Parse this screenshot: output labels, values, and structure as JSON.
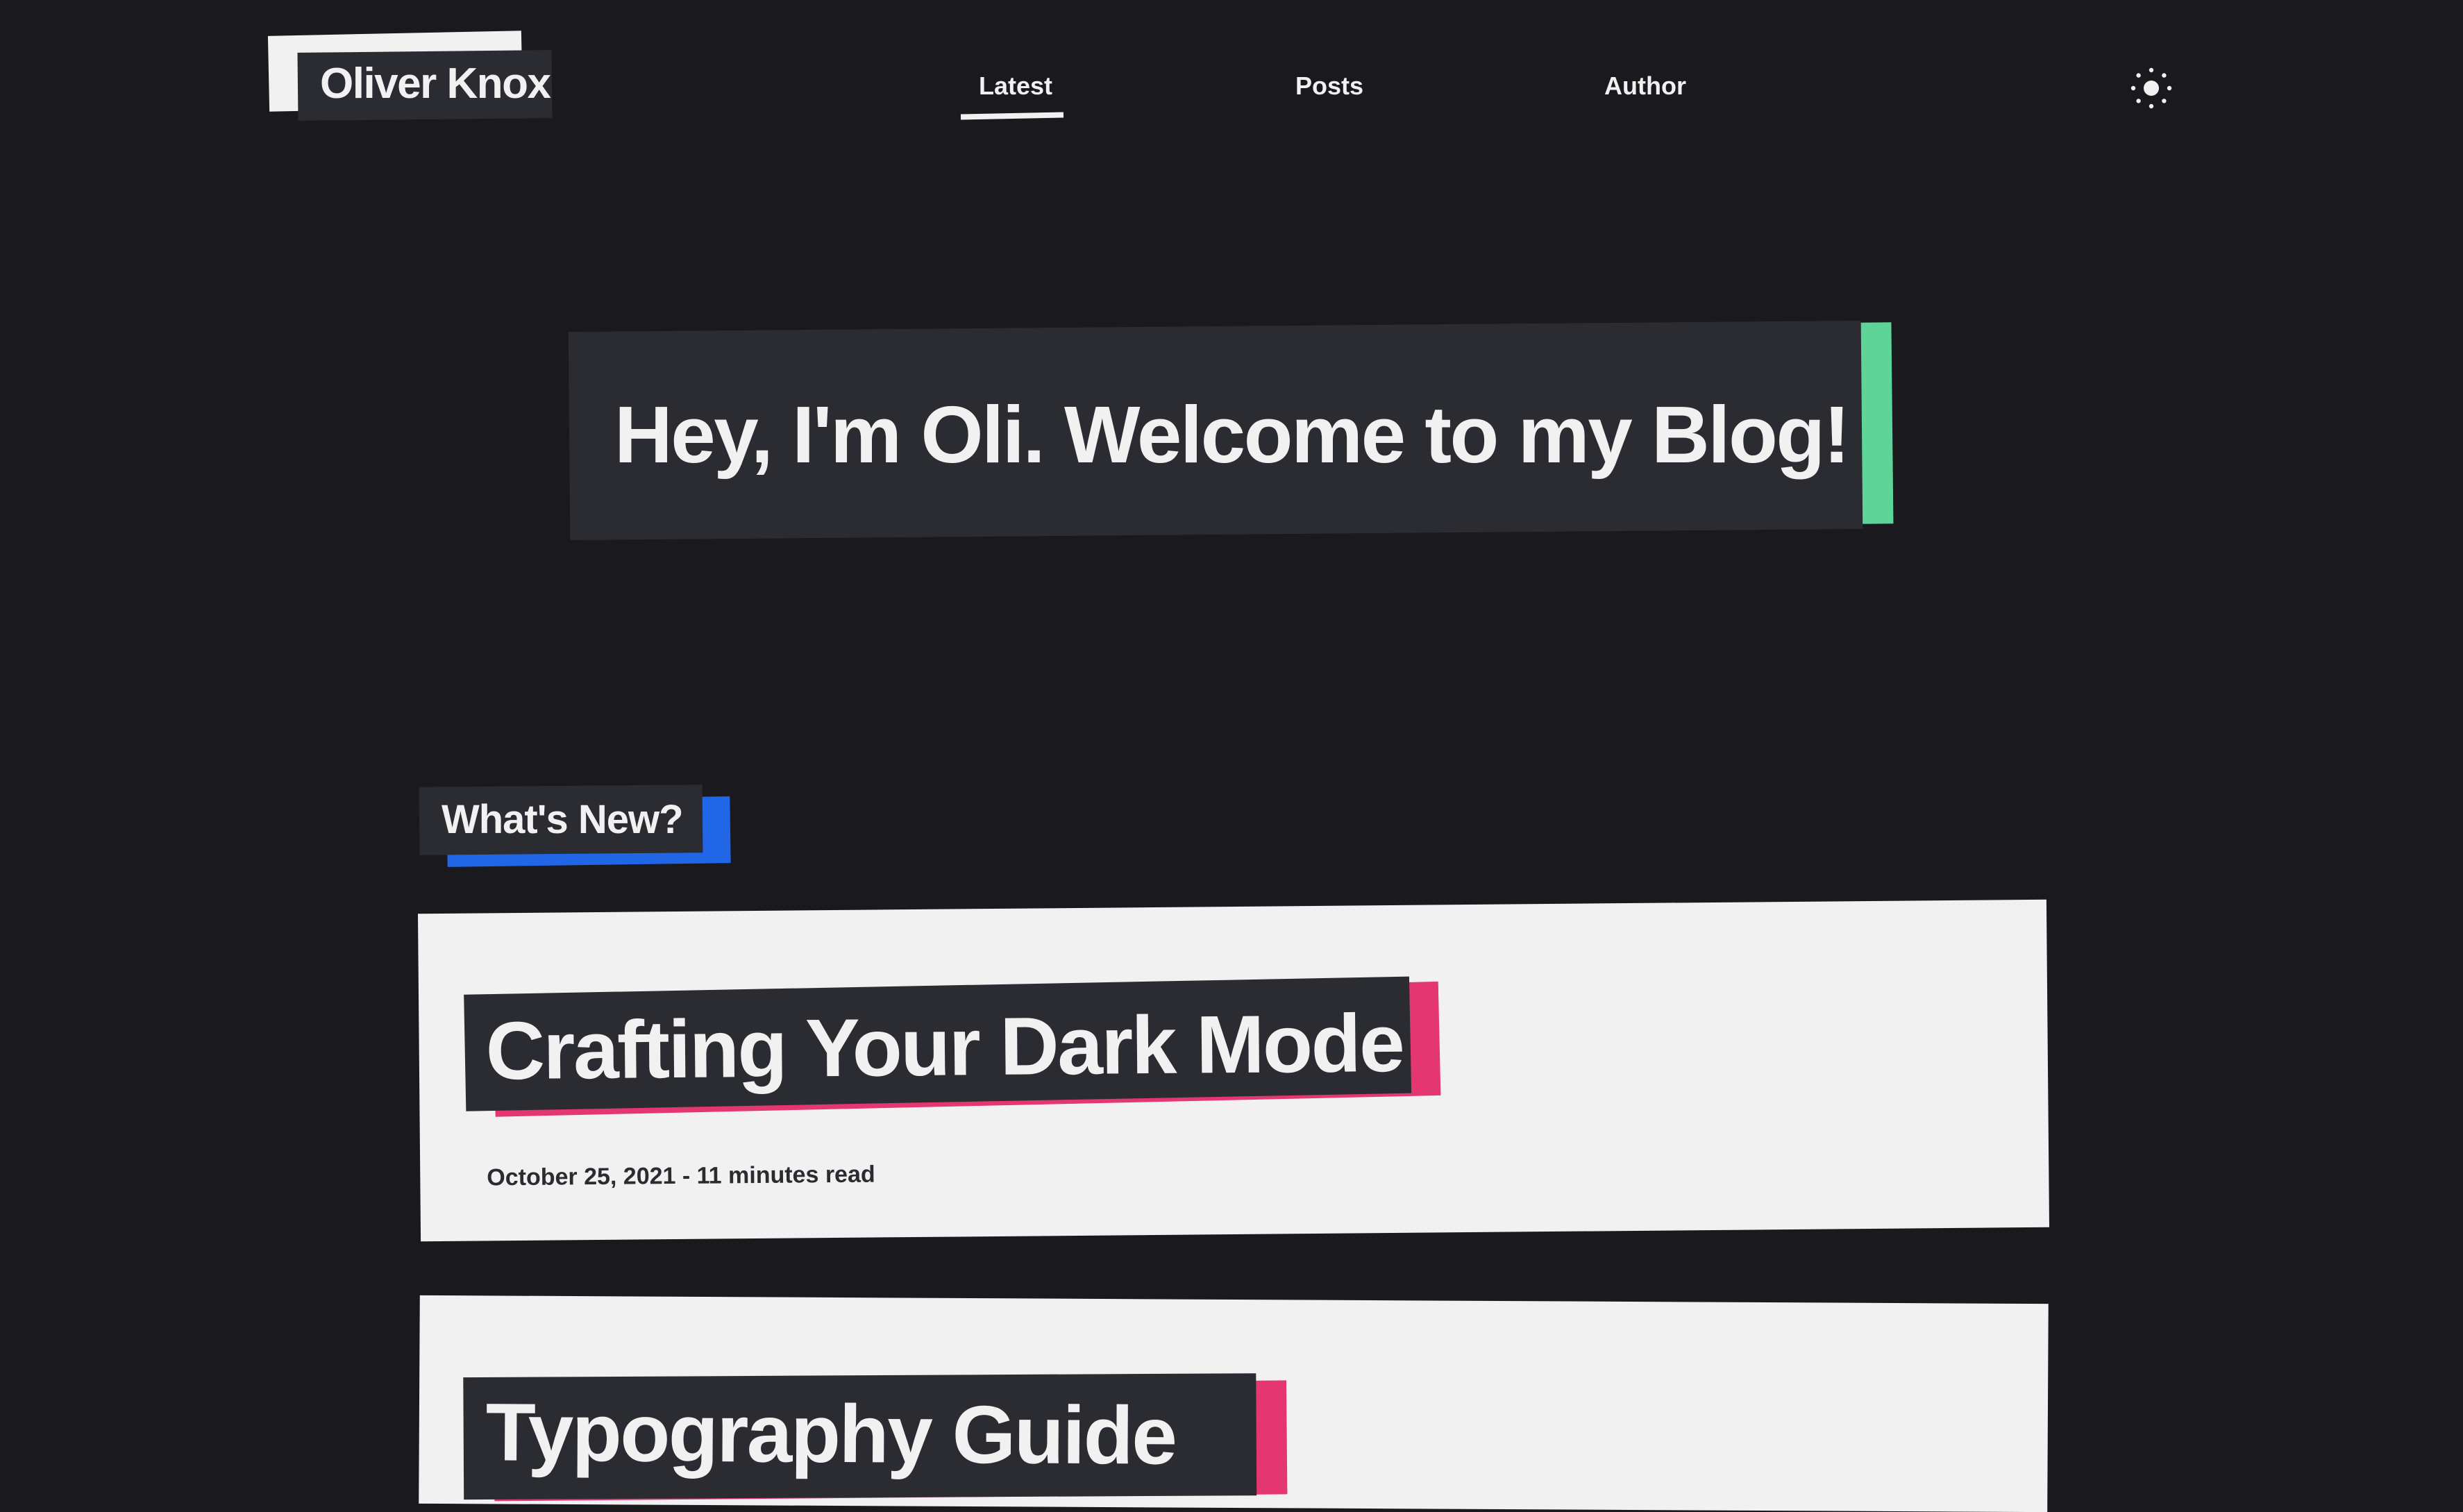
{
  "header": {
    "logo_text": "Oliver Knox",
    "nav": [
      {
        "label": "Latest",
        "active": true
      },
      {
        "label": "Posts",
        "active": false
      },
      {
        "label": "Author",
        "active": false
      }
    ],
    "theme_toggle_icon": "sun-icon"
  },
  "hero": {
    "title": "Hey, I'm Oli. Welcome to my Blog!"
  },
  "section": {
    "heading": "What's New?"
  },
  "posts": [
    {
      "title": "Crafting Your Dark Mode",
      "meta": "October 25, 2021 - 11 minutes read"
    },
    {
      "title": "Typography Guide",
      "meta": ""
    }
  ],
  "colors": {
    "background": "#1a1a1e",
    "panel": "#2b2c31",
    "text_light": "#f1f1f1",
    "accent_green": "#5fd498",
    "accent_blue": "#2266e8",
    "accent_pink": "#e43670"
  }
}
